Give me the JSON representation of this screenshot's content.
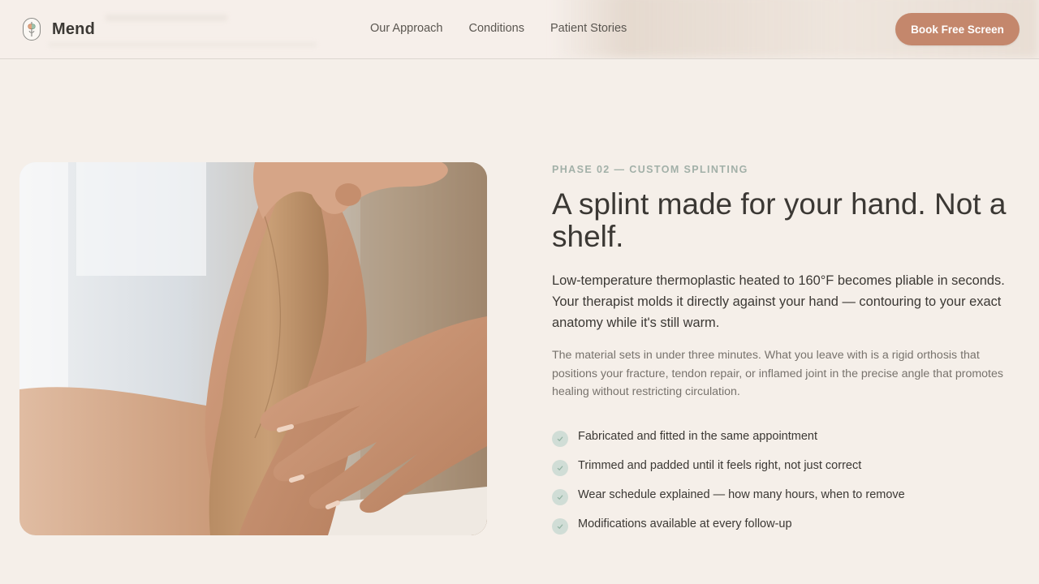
{
  "header": {
    "brand": "Mend",
    "nav": [
      {
        "label": "Our Approach"
      },
      {
        "label": "Conditions"
      },
      {
        "label": "Patient Stories"
      }
    ],
    "cta_label": "Book Free Screen"
  },
  "section": {
    "eyebrow": "PHASE 02 — CUSTOM SPLINTING",
    "headline": "A splint made for your hand. Not a shelf.",
    "lead": "Low-temperature thermoplastic heated to 160°F becomes pliable in seconds. Your therapist molds it directly against your hand — contouring to your exact anatomy while it's still warm.",
    "body": "The material sets in under three minutes. What you leave with is a rigid orthosis that positions your fracture, tendon repair, or inflamed joint in the precise angle that promotes healing without restricting circulation.",
    "checklist": [
      {
        "label": "Fabricated and fitted in the same appointment"
      },
      {
        "label": "Trimmed and padded until it feels right, not just correct"
      },
      {
        "label": "Wear schedule explained — how many hours, when to remove"
      },
      {
        "label": "Modifications available at every follow-up"
      }
    ]
  },
  "colors": {
    "background": "#f5efe9",
    "accent": "#c4876c",
    "eyebrow": "#a2b0a8",
    "check_bg": "#d0ddd6",
    "check_mark": "#8fb0a0"
  },
  "icons": {
    "logo": "hand-logo-icon",
    "check": "check-icon"
  }
}
